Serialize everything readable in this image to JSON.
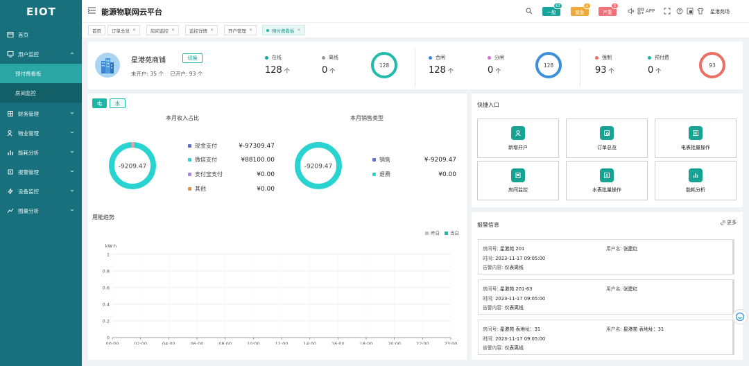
{
  "brand": {
    "logo": "EIOT"
  },
  "sidebar": {
    "items": [
      {
        "label": "首页",
        "icon": "home-icon"
      },
      {
        "label": "用户监控",
        "icon": "monitor-icon",
        "expanded": true,
        "children": [
          {
            "label": "预付费看板",
            "active": true
          },
          {
            "label": "房间监控",
            "active": false
          }
        ]
      },
      {
        "label": "财务管理",
        "icon": "finance-icon"
      },
      {
        "label": "物业管理",
        "icon": "property-icon"
      },
      {
        "label": "能耗分析",
        "icon": "chart-icon"
      },
      {
        "label": "报警管理",
        "icon": "alarm-icon"
      },
      {
        "label": "设备监控",
        "icon": "device-icon"
      },
      {
        "label": "图量分析",
        "icon": "analysis-icon"
      }
    ]
  },
  "header": {
    "title": "能源物联网云平台",
    "alerts": [
      {
        "label": "一般",
        "count": "63",
        "color": "#19a59b",
        "dot": "#19a59b"
      },
      {
        "label": "紧急",
        "count": "0",
        "color": "#f0a93b",
        "dot": "#f0a93b"
      },
      {
        "label": "严重",
        "count": "0",
        "color": "#f2727a",
        "dot": "#f2727a"
      }
    ],
    "app_label": "APP",
    "user_name": "星港苑场"
  },
  "tabs": [
    {
      "label": "首页",
      "closable": false
    },
    {
      "label": "订单总览",
      "closable": true
    },
    {
      "label": "房间监控",
      "closable": true
    },
    {
      "label": "监控详情",
      "closable": true
    },
    {
      "label": "开户管理",
      "closable": true
    },
    {
      "label": "预付费看板",
      "closable": true,
      "active": true
    }
  ],
  "store": {
    "name": "星港苑商铺",
    "switch_label": "切换",
    "unopened_label": "未开户:",
    "unopened_value": "35",
    "unopened_unit": "个",
    "opened_label": "已开户:",
    "opened_value": "93",
    "opened_unit": "个"
  },
  "kpis": {
    "online": {
      "label": "在线",
      "value": "128",
      "unit": "个",
      "color": "#18a89a"
    },
    "offline": {
      "label": "离线",
      "value": "0",
      "unit": "个",
      "color": "#9a9a9a"
    },
    "ring1": {
      "value": "128",
      "fraction": 1.0,
      "color": "#1fbcab"
    },
    "closed": {
      "label": "合闸",
      "value": "128",
      "unit": "个",
      "color": "#3c86d8"
    },
    "open": {
      "label": "分闸",
      "value": "0",
      "unit": "个",
      "color": "#d46bd8"
    },
    "ring2": {
      "value": "128",
      "fraction": 1.0,
      "color": "#3b8fdb"
    },
    "forced": {
      "label": "强制",
      "value": "93",
      "unit": "个",
      "color": "#ea6e63"
    },
    "prepaid": {
      "label": "预付费",
      "value": "0",
      "unit": "个",
      "color": "#1fb5a5"
    },
    "ring3": {
      "value": "93",
      "fraction": 1.0,
      "color": "#eb6f63"
    }
  },
  "energy_tabs": {
    "electric": "电",
    "water": "水"
  },
  "income": {
    "title": "本月收入占比",
    "center": "-9209.47",
    "rows": [
      {
        "label": "现金支付",
        "value": "¥-97309.47",
        "color": "#5b6fd4"
      },
      {
        "label": "微信支付",
        "value": "¥88100.00",
        "color": "#29d3cf"
      },
      {
        "label": "支付宝支付",
        "value": "¥0.00",
        "color": "#a986e6"
      },
      {
        "label": "其他",
        "value": "¥0.00",
        "color": "#e9924a"
      }
    ]
  },
  "sales": {
    "title": "本月销售类型",
    "center": "-9209.47",
    "rows": [
      {
        "label": "销售",
        "value": "¥-9209.47",
        "color": "#5b6fd4"
      },
      {
        "label": "退费",
        "value": "¥0.00",
        "color": "#29d3cf"
      }
    ]
  },
  "trend": {
    "title": "用能趋势"
  },
  "chart_data": {
    "type": "line",
    "title": "用能趋势",
    "ylabel": "kW·h",
    "ylim": [
      0,
      1
    ],
    "y_ticks": [
      "0",
      "0.2",
      "0.4",
      "0.6",
      "0.8",
      "1"
    ],
    "categories": [
      "00:00",
      "02:00",
      "04:00",
      "06:00",
      "08:00",
      "10:00",
      "12:00",
      "14:00",
      "16:00",
      "18:00",
      "20:00",
      "22:00",
      "23:00"
    ],
    "series": [
      {
        "name": "昨日",
        "values": [],
        "color": "#bfbfbf"
      },
      {
        "name": "当日",
        "values": [],
        "color": "#1fbcab"
      }
    ],
    "grid": true,
    "legend": "top-right"
  },
  "quick": {
    "title": "快捷入口",
    "items": [
      {
        "label": "新增开户",
        "icon": "add-user-icon"
      },
      {
        "label": "订单总览",
        "icon": "order-icon"
      },
      {
        "label": "电表批量操作",
        "icon": "meter-icon"
      },
      {
        "label": "房间监控",
        "icon": "room-icon"
      },
      {
        "label": "水表批量操作",
        "icon": "water-meter-icon"
      },
      {
        "label": "能耗分析",
        "icon": "energy-icon"
      }
    ]
  },
  "alarms": {
    "title": "报警信息",
    "more": "更多",
    "items": [
      {
        "room_label": "房间号:",
        "room": "星港苑 201",
        "user_label": "用户名:",
        "user": "张建红",
        "time_label": "时间:",
        "time": "2023-11-17 09:05:00",
        "content_label": "告警内容:",
        "content": "仪表离线"
      },
      {
        "room_label": "房间号:",
        "room": "星港苑 201-63",
        "user_label": "用户名:",
        "user": "张建红",
        "time_label": "时间:",
        "time": "2023-11-17 09:05:00",
        "content_label": "告警内容:",
        "content": "仪表离线"
      },
      {
        "room_label": "房间号:",
        "room": "星港苑 表地址：31",
        "user_label": "用户名:",
        "user": "星港苑 表地址：31",
        "time_label": "时间:",
        "time": "2023-11-17 09:05:00",
        "content_label": "告警内容:",
        "content": "仪表离线"
      }
    ]
  }
}
